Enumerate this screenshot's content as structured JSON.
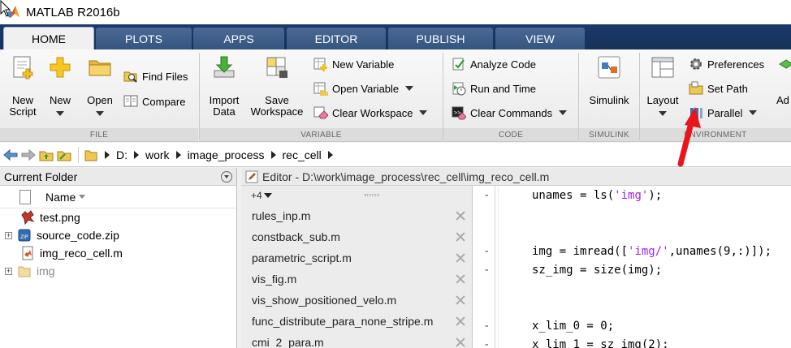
{
  "window": {
    "title": "MATLAB R2016b"
  },
  "tabs": [
    {
      "label": "HOME",
      "active": true
    },
    {
      "label": "PLOTS",
      "active": false
    },
    {
      "label": "APPS",
      "active": false
    },
    {
      "label": "EDITOR",
      "active": false
    },
    {
      "label": "PUBLISH",
      "active": false
    },
    {
      "label": "VIEW",
      "active": false
    }
  ],
  "ribbon": {
    "file": {
      "section_label": "FILE",
      "new_script": "New\nScript",
      "new": "New",
      "open": "Open",
      "find_files": "Find Files",
      "compare": "Compare"
    },
    "variable": {
      "section_label": "VARIABLE",
      "import_data": "Import\nData",
      "save_workspace": "Save\nWorkspace",
      "new_variable": "New Variable",
      "open_variable": "Open Variable",
      "clear_workspace": "Clear Workspace"
    },
    "code": {
      "section_label": "CODE",
      "analyze_code": "Analyze Code",
      "run_and_time": "Run and Time",
      "clear_commands": "Clear Commands"
    },
    "simulink": {
      "section_label": "SIMULINK",
      "simulink": "Simulink"
    },
    "environment": {
      "section_label": "ENVIRONMENT",
      "layout": "Layout",
      "preferences": "Preferences",
      "set_path": "Set Path",
      "parallel": "Parallel",
      "add_ons": "Ad"
    }
  },
  "address": {
    "drive": "D:",
    "segments": [
      "work",
      "image_process",
      "rec_cell"
    ]
  },
  "current_folder": {
    "title": "Current Folder",
    "column_name": "Name",
    "items": [
      {
        "name": "test.png",
        "type": "image",
        "expandable": false
      },
      {
        "name": "source_code.zip",
        "type": "zip",
        "expandable": true
      },
      {
        "name": "img_reco_cell.m",
        "type": "mfile",
        "expandable": false
      },
      {
        "name": "img",
        "type": "folder",
        "expandable": true
      }
    ]
  },
  "editor": {
    "title": "Editor - D:\\work\\image_process\\rec_cell\\img_reco_cell.m",
    "more_docs": "+4",
    "documents": [
      "rules_inp.m",
      "constback_sub.m",
      "parametric_script.m",
      "vis_fig.m",
      "vis_show_positioned_velo.m",
      "func_distribute_para_none_stripe.m",
      "cmi_2_para.m"
    ],
    "code_lines": [
      {
        "dash": "-",
        "pre": "unames = ls(",
        "str": "'img'",
        "post": ");"
      },
      {
        "dash": "",
        "pre": "",
        "str": "",
        "post": ""
      },
      {
        "dash": "",
        "pre": "",
        "str": "",
        "post": ""
      },
      {
        "dash": "-",
        "pre": "img = imread([",
        "str": "'img/'",
        "post": ",unames(9,:)]);"
      },
      {
        "dash": "-",
        "pre": "sz_img = size(img);",
        "str": "",
        "post": ""
      },
      {
        "dash": "",
        "pre": "",
        "str": "",
        "post": ""
      },
      {
        "dash": "",
        "pre": "",
        "str": "",
        "post": ""
      },
      {
        "dash": "-",
        "pre": "x_lim_0 = 0;",
        "str": "",
        "post": ""
      },
      {
        "dash": "-",
        "pre": "x_lim_1 = sz_img(2);",
        "str": "",
        "post": ""
      }
    ]
  },
  "colors": {
    "tab_bar": "#173159",
    "tab_inactive": "#3f608b",
    "ribbon_bg": "#f0f0f0",
    "string": "#a020f0",
    "annotation_arrow": "#e8151b"
  }
}
